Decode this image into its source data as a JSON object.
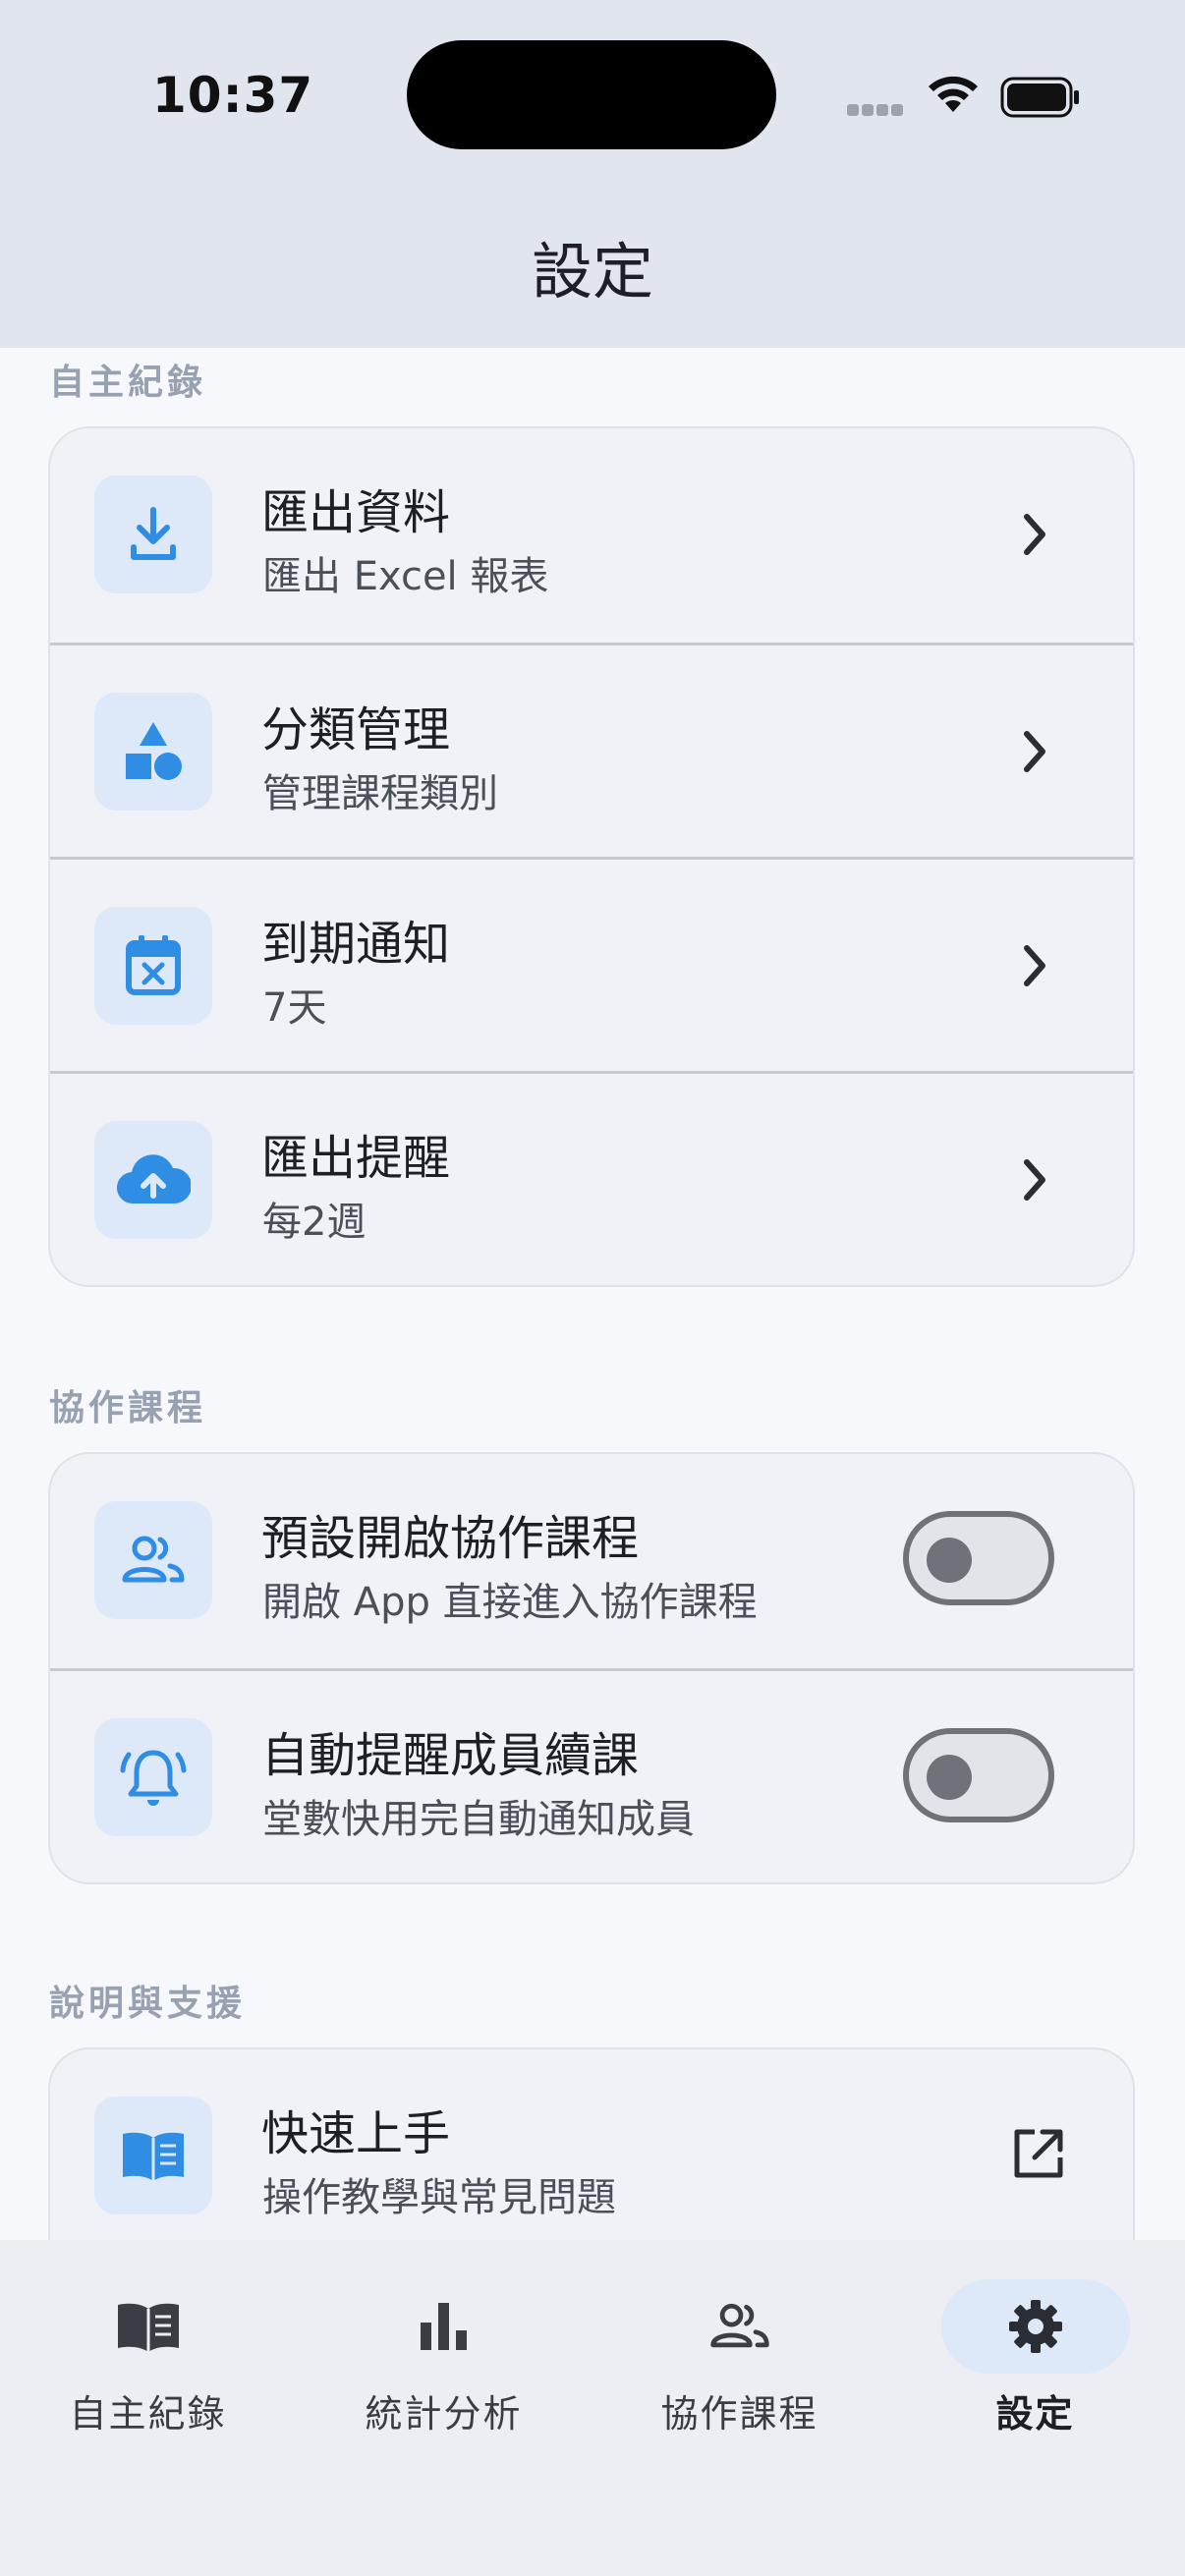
{
  "status_bar": {
    "time": "10:37"
  },
  "header": {
    "title": "設定"
  },
  "sections": [
    {
      "label": "自主紀錄",
      "items": [
        {
          "title": "匯出資料",
          "subtitle": "匯出 Excel 報表",
          "icon": "download-icon"
        },
        {
          "title": "分類管理",
          "subtitle": "管理課程類別",
          "icon": "category-shapes-icon"
        },
        {
          "title": "到期通知",
          "subtitle": "7天",
          "icon": "calendar-x-icon"
        },
        {
          "title": "匯出提醒",
          "subtitle": "每2週",
          "icon": "cloud-upload-icon"
        }
      ]
    },
    {
      "label": "協作課程",
      "items": [
        {
          "title": "預設開啟協作課程",
          "subtitle": "開啟 App 直接進入協作課程",
          "icon": "group-icon",
          "toggle": false
        },
        {
          "title": "自動提醒成員續課",
          "subtitle": "堂數快用完自動通知成員",
          "icon": "bell-ringing-icon",
          "toggle": false
        }
      ]
    },
    {
      "label": "說明與支援",
      "items": [
        {
          "title": "快速上手",
          "subtitle": "操作教學與常見問題",
          "icon": "book-icon"
        }
      ]
    }
  ],
  "bottom_nav": [
    {
      "label": "自主紀錄",
      "icon": "book-icon"
    },
    {
      "label": "統計分析",
      "icon": "bar-chart-icon"
    },
    {
      "label": "協作課程",
      "icon": "group-icon"
    },
    {
      "label": "設定",
      "icon": "gear-icon",
      "active": true
    }
  ],
  "colors": {
    "accent": "#2f8de4",
    "icon_bg": "#dde8f8",
    "app_bar": "#e1e5ee"
  }
}
